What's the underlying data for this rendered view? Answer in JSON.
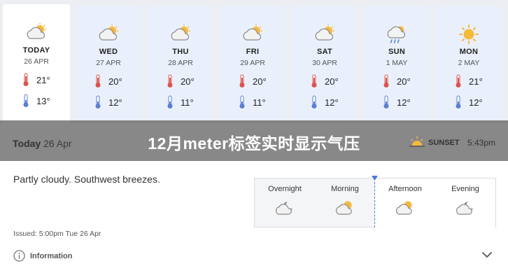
{
  "forecast": {
    "days": [
      {
        "name": "TODAY",
        "date": "26 APR",
        "high": "21°",
        "low": "13°",
        "icon": "partly-cloudy-icon"
      },
      {
        "name": "WED",
        "date": "27 APR",
        "high": "20°",
        "low": "12°",
        "icon": "partly-cloudy-icon"
      },
      {
        "name": "THU",
        "date": "28 APR",
        "high": "20°",
        "low": "11°",
        "icon": "partly-cloudy-icon"
      },
      {
        "name": "FRI",
        "date": "29 APR",
        "high": "20°",
        "low": "11°",
        "icon": "partly-cloudy-icon"
      },
      {
        "name": "SAT",
        "date": "30 APR",
        "high": "20°",
        "low": "12°",
        "icon": "partly-cloudy-icon"
      },
      {
        "name": "SUN",
        "date": "1 MAY",
        "high": "20°",
        "low": "12°",
        "icon": "showers-icon"
      },
      {
        "name": "MON",
        "date": "2 MAY",
        "high": "21°",
        "low": "12°",
        "icon": "sunny-icon"
      }
    ]
  },
  "banner": {
    "title": "12月meter标签实时显示气压",
    "today_label": "Today",
    "today_date": "26 Apr",
    "sunset_label": "SUNSET",
    "sunset_time": "5:43pm"
  },
  "detail": {
    "summary": "Partly cloudy. Southwest breezes.",
    "issued": "Issued: 5:00pm Tue 26 Apr",
    "info_label": "Information"
  },
  "periods": [
    {
      "label": "Overnight",
      "icon": "cloudy-night-icon"
    },
    {
      "label": "Morning",
      "icon": "partly-cloudy-icon"
    },
    {
      "label": "Afternoon",
      "icon": "partly-cloudy-icon"
    },
    {
      "label": "Evening",
      "icon": "cloudy-night-icon"
    }
  ],
  "colors": {
    "card_bg": "#eaf0fb",
    "accent": "#4a7cd6",
    "sun": "#f6b93b",
    "thermo_hot": "#d9534f",
    "thermo_cold": "#5b7fd0"
  }
}
